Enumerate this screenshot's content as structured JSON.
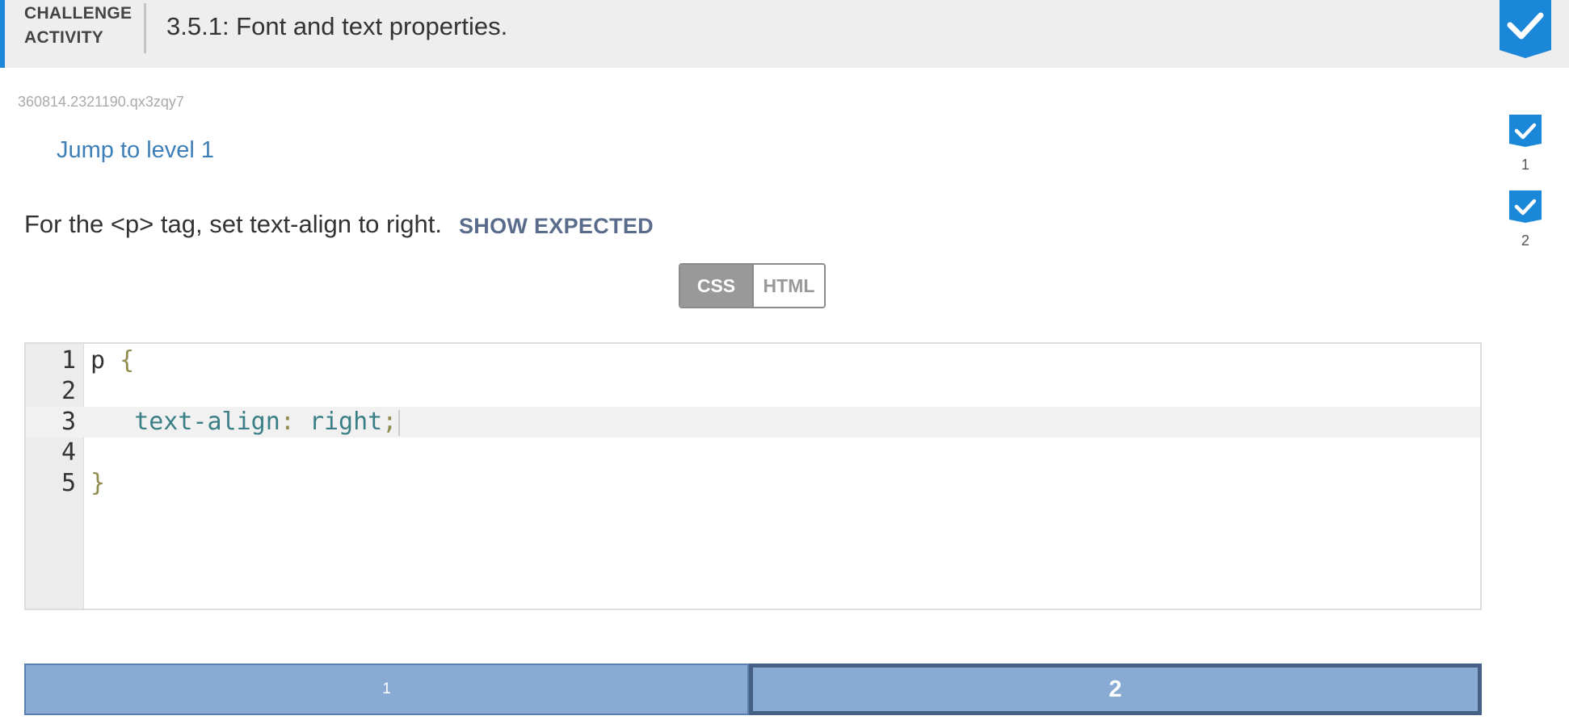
{
  "header": {
    "activity_label_line1": "CHALLENGE",
    "activity_label_line2": "ACTIVITY",
    "title": "3.5.1: Font and text properties.",
    "accent_color": "#1b87d8",
    "badge_icon": "checkmark-icon",
    "badge_color": "#1b87d8"
  },
  "activity_id": "360814.2321190.qx3zqy7",
  "jump_link": "Jump to level 1",
  "levels_sidebar": [
    {
      "number": "1",
      "icon": "checkmark-icon",
      "status": "complete"
    },
    {
      "number": "2",
      "icon": "checkmark-icon",
      "status": "complete"
    }
  ],
  "instructions": {
    "text": "For the <p> tag, set text-align to right.",
    "show_expected": "SHOW EXPECTED"
  },
  "tabs": {
    "css": "CSS",
    "html": "HTML",
    "active": "CSS"
  },
  "editor": {
    "line_numbers": [
      "1",
      "2",
      "3",
      "4",
      "5"
    ],
    "line1": {
      "selector": "p",
      "open_brace": "{"
    },
    "line3": {
      "indent": "   ",
      "property": "text-align",
      "colon": ":",
      "value": "right",
      "semicolon": ";"
    },
    "line5": {
      "close_brace": "}"
    },
    "active_line": "3"
  },
  "level_bar": {
    "level1": "1",
    "level2": "2",
    "current": "2"
  }
}
